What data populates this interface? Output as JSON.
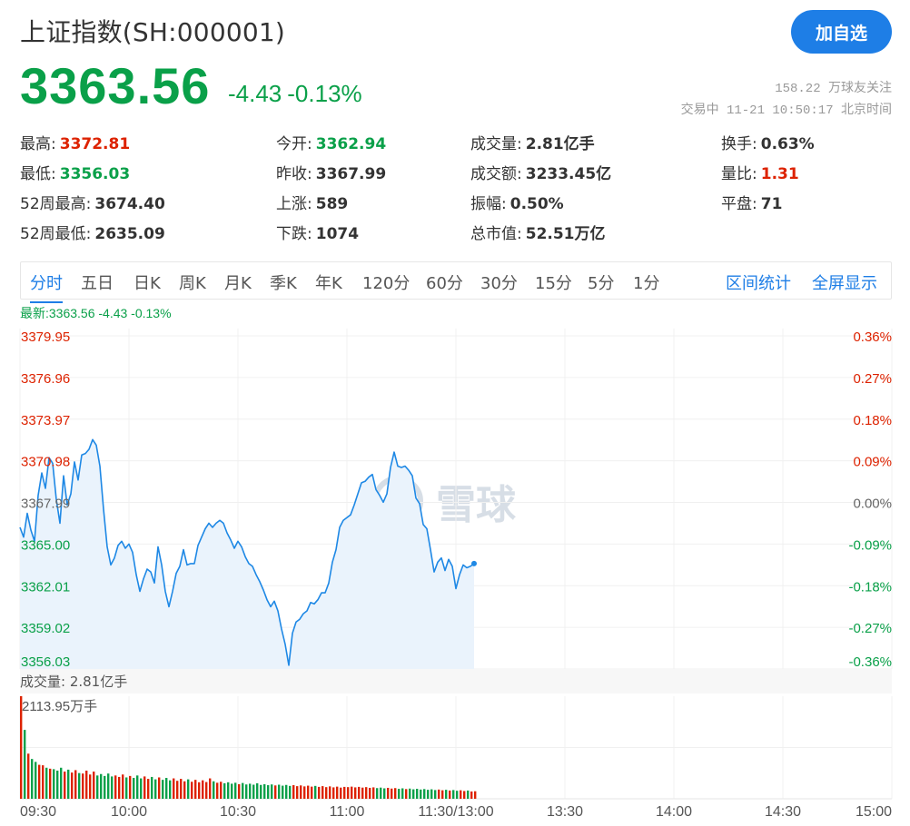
{
  "header": {
    "title": "上证指数(SH:000001)",
    "follow_label": "加自选",
    "price": "3363.56",
    "change": "-4.43",
    "change_pct": "-0.13%",
    "followers": "158.22 万球友关注",
    "status_time": "交易中 11-21 10:50:17 北京时间"
  },
  "stats": [
    {
      "label": "最高:",
      "value": "3372.81",
      "trend": "up"
    },
    {
      "label": "最低:",
      "value": "3356.03",
      "trend": "down"
    },
    {
      "label": "52周最高:",
      "value": "3674.40",
      "trend": ""
    },
    {
      "label": "52周最低:",
      "value": "2635.09",
      "trend": ""
    },
    {
      "label": "今开:",
      "value": "3362.94",
      "trend": "down"
    },
    {
      "label": "昨收:",
      "value": "3367.99",
      "trend": ""
    },
    {
      "label": "上涨:",
      "value": "589",
      "trend": ""
    },
    {
      "label": "下跌:",
      "value": "1074",
      "trend": ""
    },
    {
      "label": "成交量:",
      "value": "2.81亿手",
      "trend": ""
    },
    {
      "label": "成交额:",
      "value": "3233.45亿",
      "trend": ""
    },
    {
      "label": "振幅:",
      "value": "0.50%",
      "trend": ""
    },
    {
      "label": "总市值:",
      "value": "52.51万亿",
      "trend": ""
    },
    {
      "label": "换手:",
      "value": "0.63%",
      "trend": ""
    },
    {
      "label": "量比:",
      "value": "1.31",
      "trend": "up"
    },
    {
      "label": "平盘:",
      "value": "71",
      "trend": ""
    }
  ],
  "tabs": [
    "分时",
    "五日",
    "日K",
    "周K",
    "月K",
    "季K",
    "年K",
    "120分",
    "60分",
    "30分",
    "15分",
    "5分",
    "1分"
  ],
  "active_tab": "分时",
  "tools": [
    "区间统计",
    "全屏显示"
  ],
  "latest_line": "最新:3363.56 -4.43 -0.13%",
  "watermark_text": "雪球",
  "volume_label": "成交量: 2.81亿手",
  "colors": {
    "up": "#dd2200",
    "down": "#0aa049",
    "accent": "#1e7ee6",
    "line": "#1e88e5",
    "fill": "#eaf3fc"
  },
  "chart_data": {
    "type": "line",
    "ylim": [
      3356.03,
      3379.95
    ],
    "prev_close": 3367.99,
    "y_ticks": [
      "3379.95",
      "3376.96",
      "3373.97",
      "3370.98",
      "3367.99",
      "3365.00",
      "3362.01",
      "3359.02",
      "3356.03"
    ],
    "pct_ticks": [
      "0.36%",
      "0.27%",
      "0.18%",
      "0.09%",
      "0.00%",
      "-0.09%",
      "-0.18%",
      "-0.27%",
      "-0.36%"
    ],
    "x_ticks": [
      "09:30",
      "10:00",
      "10:30",
      "11:00",
      "11:30/13:00",
      "13:30",
      "14:00",
      "14:30",
      "15:00"
    ],
    "total_minutes": 240,
    "price": [
      3366.2,
      3365.5,
      3367.2,
      3366.0,
      3365.2,
      3368.5,
      3370.1,
      3369.0,
      3371.2,
      3370.8,
      3368.2,
      3366.5,
      3369.9,
      3367.8,
      3368.6,
      3370.9,
      3369.6,
      3371.4,
      3371.5,
      3371.8,
      3372.5,
      3372.1,
      3370.6,
      3367.5,
      3364.8,
      3363.5,
      3364.0,
      3364.9,
      3365.2,
      3364.7,
      3365.0,
      3364.4,
      3362.8,
      3361.6,
      3362.5,
      3363.2,
      3363.0,
      3362.2,
      3364.8,
      3363.5,
      3361.6,
      3360.5,
      3361.6,
      3362.9,
      3363.4,
      3364.6,
      3363.5,
      3363.6,
      3363.6,
      3364.9,
      3365.5,
      3366.1,
      3366.5,
      3366.2,
      3366.5,
      3366.7,
      3366.5,
      3365.8,
      3365.3,
      3364.7,
      3365.2,
      3364.8,
      3364.1,
      3363.6,
      3363.4,
      3362.8,
      3362.3,
      3361.7,
      3361.0,
      3360.5,
      3360.9,
      3360.2,
      3358.9,
      3357.8,
      3356.3,
      3358.6,
      3359.4,
      3359.6,
      3360.0,
      3360.2,
      3360.8,
      3360.7,
      3361.0,
      3361.5,
      3361.5,
      3362.2,
      3363.7,
      3364.6,
      3366.2,
      3366.7,
      3366.9,
      3367.1,
      3367.8,
      3368.6,
      3369.4,
      3369.5,
      3369.8,
      3370.0,
      3368.9,
      3368.5,
      3368.0,
      3368.6,
      3370.5,
      3371.6,
      3370.6,
      3370.5,
      3370.6,
      3370.3,
      3369.9,
      3368.3,
      3367.9,
      3366.4,
      3366.1,
      3364.6,
      3363.0,
      3363.7,
      3364.0,
      3363.1,
      3363.9,
      3363.4,
      3361.8,
      3362.8,
      3363.5,
      3363.3,
      3363.4,
      3363.6
    ],
    "volume": [
      2113.95,
      1420,
      930,
      820,
      760,
      700,
      690,
      640,
      620,
      610,
      580,
      640,
      560,
      600,
      540,
      590,
      530,
      520,
      580,
      500,
      560,
      480,
      510,
      470,
      520,
      460,
      480,
      450,
      500,
      440,
      470,
      430,
      480,
      420,
      460,
      410,
      450,
      400,
      440,
      390,
      430,
      380,
      420,
      370,
      410,
      360,
      400,
      350,
      390,
      340,
      380,
      345,
      420,
      360,
      330,
      350,
      320,
      340,
      310,
      330,
      300,
      325,
      295,
      310,
      290,
      320,
      285,
      300,
      280,
      295,
      275,
      290,
      270,
      285,
      265,
      280,
      260,
      275,
      255,
      270,
      250,
      265,
      245,
      260,
      240,
      255,
      235,
      250,
      230,
      245,
      240,
      250,
      235,
      245,
      230,
      240,
      225,
      235,
      220,
      230,
      215,
      225,
      210,
      220,
      205,
      215,
      200,
      210,
      195,
      205,
      190,
      200,
      185,
      195,
      180,
      190,
      175,
      185,
      170,
      180,
      165,
      175,
      160,
      170,
      150,
      155
    ],
    "volume_unit_label": "2113.95万手"
  }
}
